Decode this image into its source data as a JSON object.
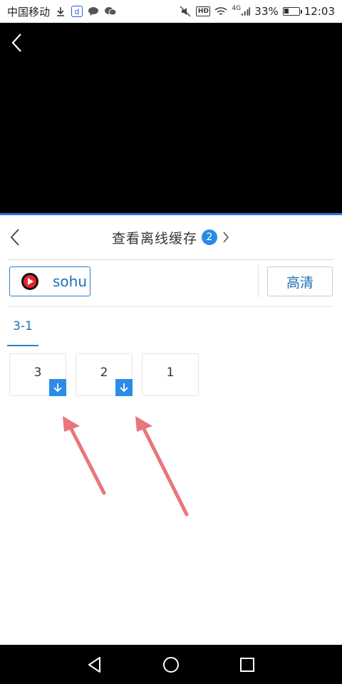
{
  "status_bar": {
    "carrier": "中国移动",
    "network": "4G",
    "battery_percent": "33%",
    "battery_level": 0.33,
    "time": "12:03",
    "hd_label": "HD"
  },
  "panel": {
    "title": "查看离线缓存",
    "badge_count": "2"
  },
  "source": {
    "label": "sohu"
  },
  "quality": {
    "label": "高清"
  },
  "tabs": [
    {
      "label": "3-1",
      "active": true
    }
  ],
  "episodes": [
    {
      "label": "3",
      "downloaded": true
    },
    {
      "label": "2",
      "downloaded": true
    },
    {
      "label": "1",
      "downloaded": false
    }
  ],
  "colors": {
    "accent": "#2a8be6",
    "video_bg": "#000000",
    "annotation_arrow": "#e8767b"
  }
}
